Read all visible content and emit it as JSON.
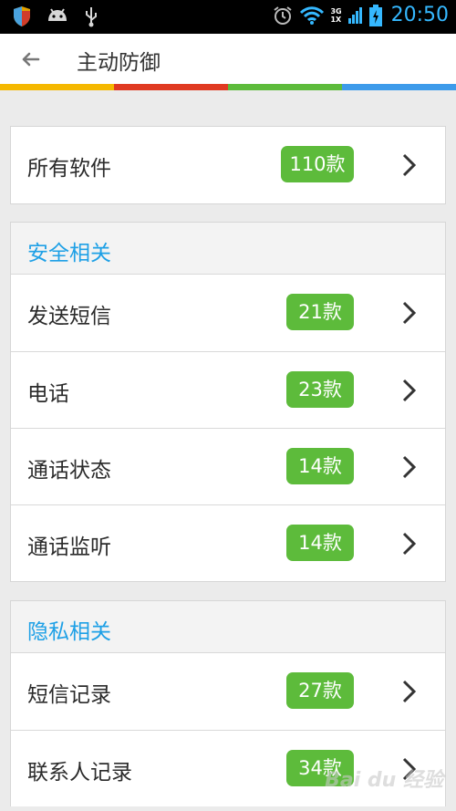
{
  "status_bar": {
    "time": "20:50",
    "net_a": "3G",
    "net_b": "1X"
  },
  "header": {
    "title": "主动防御",
    "stripe_colors": [
      "#f5b800",
      "#e03a22",
      "#5dbb3b",
      "#3d9bea"
    ]
  },
  "all_software": {
    "label": "所有软件",
    "count": "110款"
  },
  "security": {
    "title": "安全相关",
    "items": [
      {
        "label": "发送短信",
        "count": "21款"
      },
      {
        "label": "电话",
        "count": "23款"
      },
      {
        "label": "通话状态",
        "count": "14款"
      },
      {
        "label": "通话监听",
        "count": "14款"
      }
    ]
  },
  "privacy": {
    "title": "隐私相关",
    "items": [
      {
        "label": "短信记录",
        "count": "27款"
      },
      {
        "label": "联系人记录",
        "count": "34款"
      }
    ]
  },
  "watermark": "Bai du 经验"
}
